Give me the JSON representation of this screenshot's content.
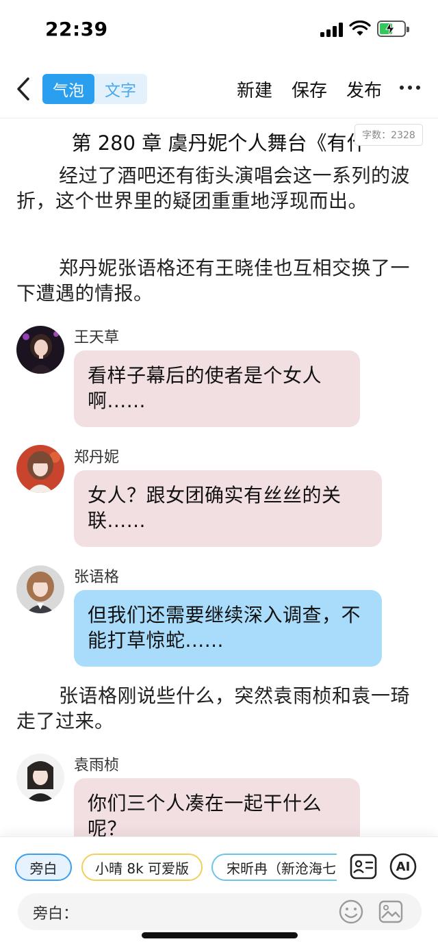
{
  "status_bar": {
    "time": "22:39"
  },
  "toolbar": {
    "mode_bubble": "气泡",
    "mode_text": "文字",
    "new_label": "新建",
    "save_label": "保存",
    "publish_label": "发布"
  },
  "chapter": {
    "title": "第 280 章  虞丹妮个人舞台《有什",
    "word_count": "字数：2328"
  },
  "paragraphs": [
    "经过了酒吧还有街头演唱会这一系列的波折，这个世界里的疑团重重地浮现而出。",
    "郑丹妮张语格还有王晓佳也互相交换了一下遭遇的情报。",
    "张语格刚说些什么，突然袁雨桢和袁一琦走了过来。"
  ],
  "messages": [
    {
      "name": "王天草",
      "text": "看样子幕后的使者是个女人啊......",
      "color": "pink",
      "avatar": "avatar-wang"
    },
    {
      "name": "郑丹妮",
      "text": "女人？跟女团确实有丝丝的关联......",
      "color": "pink",
      "avatar": "avatar-zheng"
    },
    {
      "name": "张语格",
      "text": "但我们还需要继续深入调查，不能打草惊蛇......",
      "color": "blue",
      "avatar": "avatar-zhang"
    },
    {
      "name": "袁雨桢",
      "text": "你们三个人凑在一起干什么呢？",
      "color": "pink",
      "avatar": "avatar-yuan"
    }
  ],
  "bottom": {
    "chips": [
      "旁白",
      "小晴 8k 可爱版",
      "宋昕冉（新沧海七"
    ],
    "ai_label": "AI",
    "input_label": "旁白："
  },
  "colors": {
    "accent_blue": "#2a9ff0",
    "bubble_pink": "#f2dfe2",
    "bubble_blue": "#a9dcfb",
    "battery_green": "#34c759"
  },
  "icons": [
    "back-chevron-icon",
    "more-dots-icon",
    "signal-icon",
    "wifi-icon",
    "battery-charging-icon",
    "contact-card-icon",
    "emoji-icon",
    "image-icon"
  ]
}
